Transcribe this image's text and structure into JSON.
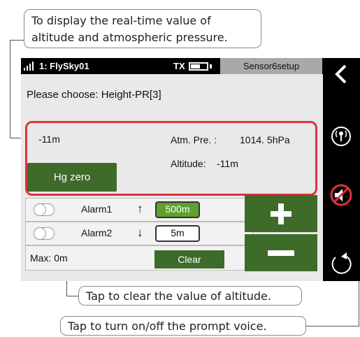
{
  "callouts": {
    "top_line1": "To display the real-time value of",
    "top_line2": "altitude and atmospheric pressure.",
    "middle": "Tap to clear the value of altitude.",
    "bottom": "Tap to turn on/off the prompt voice."
  },
  "status_bar": {
    "model_name": "1: FlySky01",
    "tx_label": "TX",
    "setup_tab": "Sensor6setup"
  },
  "main": {
    "choose_text": "Please choose: Height-PR[3]",
    "height_value": "-11m",
    "atm_label": "Atm. Pre. :",
    "atm_value": "1014. 5hPa",
    "altitude_label": "Altitude:",
    "altitude_value": "-11m",
    "hg_zero_label": "Hg zero",
    "alarm1_label": "Alarm1",
    "alarm1_value": "500m",
    "alarm2_label": "Alarm2",
    "alarm2_value": "5m",
    "max_label": "Max: 0m",
    "clear_label": "Clear"
  },
  "icons": {
    "back": "chevron-left-icon",
    "signal": "signal-icon",
    "sensor": "antenna-sensor-icon",
    "voice": "speaker-muted-icon",
    "refresh": "refresh-icon",
    "plus": "plus-icon",
    "minus": "minus-icon"
  },
  "colors": {
    "button_green": "#3e6a2a",
    "alarm_green": "#5fa12f",
    "highlight_red": "#e0313a",
    "sidebar_black": "#000000"
  }
}
